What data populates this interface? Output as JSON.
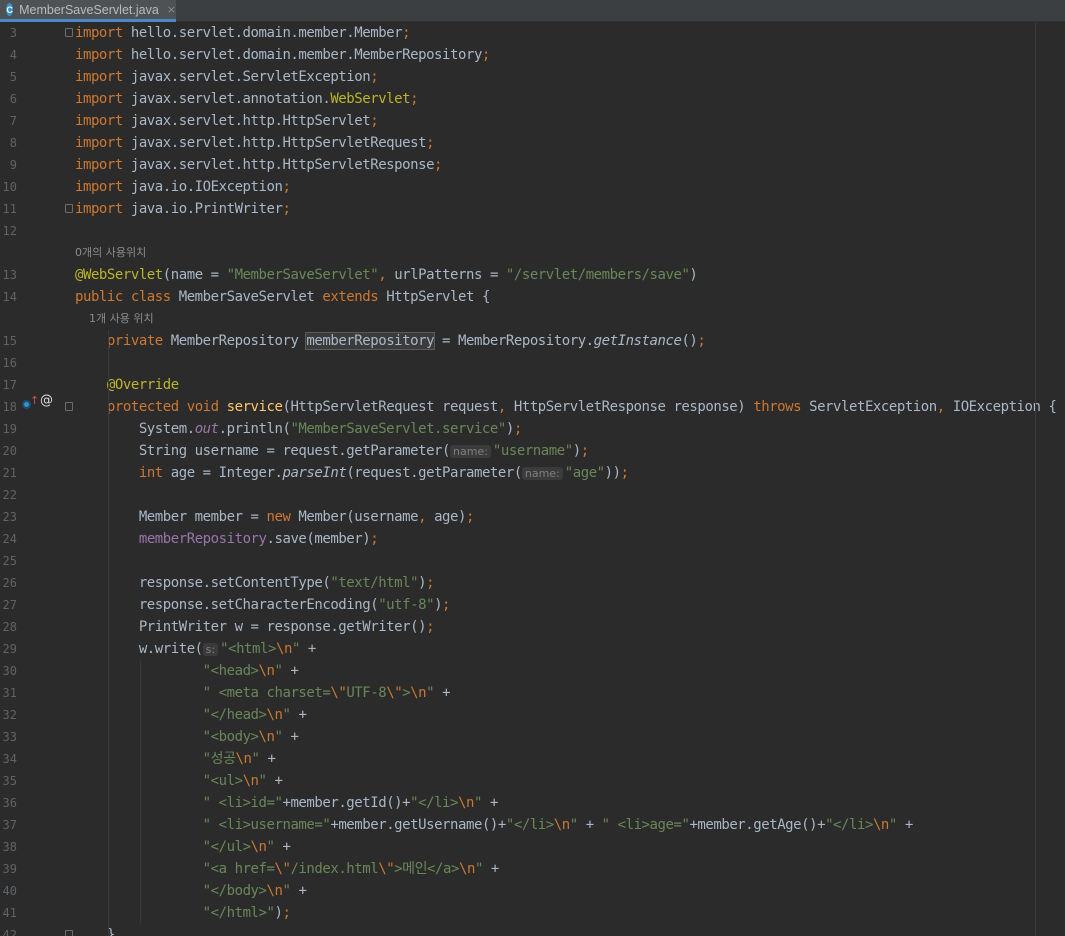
{
  "tab": {
    "label": "MemberSaveServlet.java",
    "icon": "class-c-icon",
    "icon_letter": "C",
    "close_glyph": "×",
    "accent": "#4a88c7"
  },
  "editor": {
    "first_line": 3,
    "lines": [
      [
        [
          "k",
          "import"
        ],
        [
          "t",
          " hello.servlet.domain.member.Member"
        ],
        [
          "k",
          ";"
        ]
      ],
      [
        [
          "k",
          "import"
        ],
        [
          "t",
          " hello.servlet.domain.member.MemberRepository"
        ],
        [
          "k",
          ";"
        ]
      ],
      [
        [
          "k",
          "import"
        ],
        [
          "t",
          " javax.servlet.ServletException"
        ],
        [
          "k",
          ";"
        ]
      ],
      [
        [
          "k",
          "import"
        ],
        [
          "t",
          " javax.servlet.annotation."
        ],
        [
          "a",
          "WebServlet"
        ],
        [
          "k",
          ";"
        ]
      ],
      [
        [
          "k",
          "import"
        ],
        [
          "t",
          " javax.servlet.http.HttpServlet"
        ],
        [
          "k",
          ";"
        ]
      ],
      [
        [
          "k",
          "import"
        ],
        [
          "t",
          " javax.servlet.http.HttpServletRequest"
        ],
        [
          "k",
          ";"
        ]
      ],
      [
        [
          "k",
          "import"
        ],
        [
          "t",
          " javax.servlet.http.HttpServletResponse"
        ],
        [
          "k",
          ";"
        ]
      ],
      [
        [
          "k",
          "import"
        ],
        [
          "t",
          " java.io.IOException"
        ],
        [
          "k",
          ";"
        ]
      ],
      [
        [
          "k",
          "import"
        ],
        [
          "t",
          " java.io.PrintWriter"
        ],
        [
          "k",
          ";"
        ]
      ],
      [],
      {
        "inlay": "0개의 사용위치"
      },
      [
        [
          "a",
          "@WebServlet"
        ],
        [
          "t",
          "(name = "
        ],
        [
          "s",
          "\"MemberSaveServlet\""
        ],
        [
          "k",
          ","
        ],
        [
          "t",
          " urlPatterns = "
        ],
        [
          "s",
          "\"/servlet/members/save\""
        ],
        [
          "t",
          ")"
        ]
      ],
      [
        [
          "k",
          "public class"
        ],
        [
          "t",
          " MemberSaveServlet "
        ],
        [
          "k",
          "extends"
        ],
        [
          "t",
          " HttpServlet {"
        ]
      ],
      {
        "inlay": "    1개 사용 위치"
      },
      [
        [
          "t",
          "    "
        ],
        [
          "k",
          "private"
        ],
        [
          "t",
          " MemberRepository "
        ],
        [
          "hl",
          "memberRepository"
        ],
        [
          "t",
          " = MemberRepository."
        ],
        [
          "mi",
          "getInstance"
        ],
        [
          "t",
          "()"
        ],
        [
          "k",
          ";"
        ]
      ],
      [],
      [
        [
          "t",
          "    "
        ],
        [
          "a",
          "@Override"
        ]
      ],
      [
        [
          "t",
          "    "
        ],
        [
          "k",
          "protected void"
        ],
        [
          "t",
          " "
        ],
        [
          "m",
          "service"
        ],
        [
          "t",
          "(HttpServletRequest request"
        ],
        [
          "k",
          ","
        ],
        [
          "t",
          " HttpServletResponse response) "
        ],
        [
          "k",
          "throws"
        ],
        [
          "t",
          " ServletException"
        ],
        [
          "k",
          ","
        ],
        [
          "t",
          " IOException {"
        ]
      ],
      [
        [
          "t",
          "        System."
        ],
        [
          "fi",
          "out"
        ],
        [
          "t",
          ".println("
        ],
        [
          "s",
          "\"MemberSaveServlet.service\""
        ],
        [
          "t",
          ")"
        ],
        [
          "k",
          ";"
        ]
      ],
      [
        [
          "t",
          "        String username = request.getParameter("
        ],
        [
          "h",
          "name:"
        ],
        [
          "s",
          "\"username\""
        ],
        [
          "t",
          ")"
        ],
        [
          "k",
          ";"
        ]
      ],
      [
        [
          "t",
          "        "
        ],
        [
          "k",
          "int"
        ],
        [
          "t",
          " age = Integer."
        ],
        [
          "mi",
          "parseInt"
        ],
        [
          "t",
          "(request.getParameter("
        ],
        [
          "h",
          "name:"
        ],
        [
          "s",
          "\"age\""
        ],
        [
          "t",
          "))"
        ],
        [
          "k",
          ";"
        ]
      ],
      [],
      [
        [
          "t",
          "        Member member = "
        ],
        [
          "k",
          "new"
        ],
        [
          "t",
          " Member(username"
        ],
        [
          "k",
          ","
        ],
        [
          "t",
          " age)"
        ],
        [
          "k",
          ";"
        ]
      ],
      [
        [
          "t",
          "        "
        ],
        [
          "f",
          "memberRepository"
        ],
        [
          "t",
          ".save(member)"
        ],
        [
          "k",
          ";"
        ]
      ],
      [],
      [
        [
          "t",
          "        response.setContentType("
        ],
        [
          "s",
          "\"text/html\""
        ],
        [
          "t",
          ")"
        ],
        [
          "k",
          ";"
        ]
      ],
      [
        [
          "t",
          "        response.setCharacterEncoding("
        ],
        [
          "s",
          "\"utf-8\""
        ],
        [
          "t",
          ")"
        ],
        [
          "k",
          ";"
        ]
      ],
      [
        [
          "t",
          "        PrintWriter w = response.getWriter()"
        ],
        [
          "k",
          ";"
        ]
      ],
      [
        [
          "t",
          "        w.write("
        ],
        [
          "h",
          "s:"
        ],
        [
          "s",
          "\"<html>"
        ],
        [
          "k",
          "\\n"
        ],
        [
          "s",
          "\""
        ],
        [
          "t",
          " +"
        ]
      ],
      [
        [
          "t",
          "                "
        ],
        [
          "s",
          "\"<head>"
        ],
        [
          "k",
          "\\n"
        ],
        [
          "s",
          "\""
        ],
        [
          "t",
          " +"
        ]
      ],
      [
        [
          "t",
          "                "
        ],
        [
          "s",
          "\" <meta charset="
        ],
        [
          "k",
          "\\\""
        ],
        [
          "s",
          "UTF-8"
        ],
        [
          "k",
          "\\\""
        ],
        [
          "s",
          ">"
        ],
        [
          "k",
          "\\n"
        ],
        [
          "s",
          "\""
        ],
        [
          "t",
          " +"
        ]
      ],
      [
        [
          "t",
          "                "
        ],
        [
          "s",
          "\"</head>"
        ],
        [
          "k",
          "\\n"
        ],
        [
          "s",
          "\""
        ],
        [
          "t",
          " +"
        ]
      ],
      [
        [
          "t",
          "                "
        ],
        [
          "s",
          "\"<body>"
        ],
        [
          "k",
          "\\n"
        ],
        [
          "s",
          "\""
        ],
        [
          "t",
          " +"
        ]
      ],
      [
        [
          "t",
          "                "
        ],
        [
          "s",
          "\"성공"
        ],
        [
          "k",
          "\\n"
        ],
        [
          "s",
          "\""
        ],
        [
          "t",
          " +"
        ]
      ],
      [
        [
          "t",
          "                "
        ],
        [
          "s",
          "\"<ul>"
        ],
        [
          "k",
          "\\n"
        ],
        [
          "s",
          "\""
        ],
        [
          "t",
          " +"
        ]
      ],
      [
        [
          "t",
          "                "
        ],
        [
          "s",
          "\" <li>id=\""
        ],
        [
          "t",
          "+member.getId()+"
        ],
        [
          "s",
          "\"</li>"
        ],
        [
          "k",
          "\\n"
        ],
        [
          "s",
          "\""
        ],
        [
          "t",
          " +"
        ]
      ],
      [
        [
          "t",
          "                "
        ],
        [
          "s",
          "\" <li>username=\""
        ],
        [
          "t",
          "+member.getUsername()+"
        ],
        [
          "s",
          "\"</li>"
        ],
        [
          "k",
          "\\n"
        ],
        [
          "s",
          "\""
        ],
        [
          "t",
          " + "
        ],
        [
          "s",
          "\" <li>age=\""
        ],
        [
          "t",
          "+member.getAge()+"
        ],
        [
          "s",
          "\"</li>"
        ],
        [
          "k",
          "\\n"
        ],
        [
          "s",
          "\""
        ],
        [
          "t",
          " +"
        ]
      ],
      [
        [
          "t",
          "                "
        ],
        [
          "s",
          "\"</ul>"
        ],
        [
          "k",
          "\\n"
        ],
        [
          "s",
          "\""
        ],
        [
          "t",
          " +"
        ]
      ],
      [
        [
          "t",
          "                "
        ],
        [
          "s",
          "\"<a href="
        ],
        [
          "k",
          "\\\""
        ],
        [
          "s",
          "/index.html"
        ],
        [
          "k",
          "\\\""
        ],
        [
          "s",
          ">메인</a>"
        ],
        [
          "k",
          "\\n"
        ],
        [
          "s",
          "\""
        ],
        [
          "t",
          " +"
        ]
      ],
      [
        [
          "t",
          "                "
        ],
        [
          "s",
          "\"</body>"
        ],
        [
          "k",
          "\\n"
        ],
        [
          "s",
          "\""
        ],
        [
          "t",
          " +"
        ]
      ],
      [
        [
          "t",
          "                "
        ],
        [
          "s",
          "\"</html>\""
        ],
        [
          "t",
          ")"
        ],
        [
          "k",
          ";"
        ]
      ],
      [
        [
          "t",
          "    }"
        ]
      ]
    ],
    "gutter": {
      "override_icon": "override-method-icon",
      "arrow_glyph": "↑",
      "annotation_glyph": "@"
    }
  }
}
